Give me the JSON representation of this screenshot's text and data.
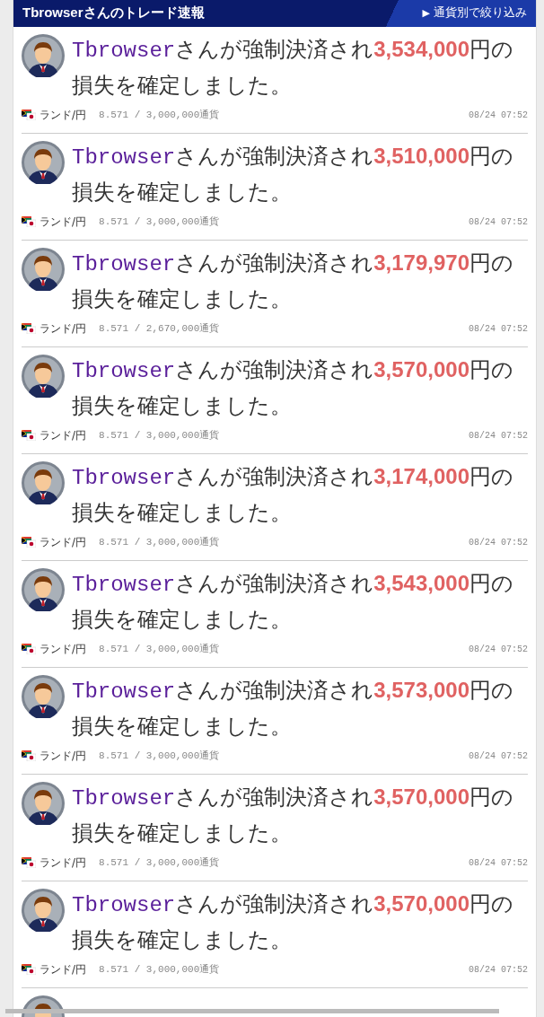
{
  "header": {
    "title": "Tbrowserさんのトレード速報",
    "filter_icon": "▶",
    "filter_label": "通貨別で絞り込み"
  },
  "items": [
    {
      "user": "Tbrowser",
      "text_before": "さんが強制決済され",
      "amount": "3,534,000",
      "text_after": "円の損失を確定しました。",
      "pair": "ランド/円",
      "detail": "8.571 / 3,000,000通貨",
      "time": "08/24 07:52"
    },
    {
      "user": "Tbrowser",
      "text_before": "さんが強制決済され",
      "amount": "3,510,000",
      "text_after": "円の損失を確定しました。",
      "pair": "ランド/円",
      "detail": "8.571 / 3,000,000通貨",
      "time": "08/24 07:52"
    },
    {
      "user": "Tbrowser",
      "text_before": "さんが強制決済され",
      "amount": "3,179,970",
      "text_after": "円の損失を確定しました。",
      "pair": "ランド/円",
      "detail": "8.571 / 2,670,000通貨",
      "time": "08/24 07:52"
    },
    {
      "user": "Tbrowser",
      "text_before": "さんが強制決済され",
      "amount": "3,570,000",
      "text_after": "円の損失を確定しました。",
      "pair": "ランド/円",
      "detail": "8.571 / 3,000,000通貨",
      "time": "08/24 07:52"
    },
    {
      "user": "Tbrowser",
      "text_before": "さんが強制決済され",
      "amount": "3,174,000",
      "text_after": "円の損失を確定しました。",
      "pair": "ランド/円",
      "detail": "8.571 / 3,000,000通貨",
      "time": "08/24 07:52"
    },
    {
      "user": "Tbrowser",
      "text_before": "さんが強制決済され",
      "amount": "3,543,000",
      "text_after": "円の損失を確定しました。",
      "pair": "ランド/円",
      "detail": "8.571 / 3,000,000通貨",
      "time": "08/24 07:52"
    },
    {
      "user": "Tbrowser",
      "text_before": "さんが強制決済され",
      "amount": "3,573,000",
      "text_after": "円の損失を確定しました。",
      "pair": "ランド/円",
      "detail": "8.571 / 3,000,000通貨",
      "time": "08/24 07:52"
    },
    {
      "user": "Tbrowser",
      "text_before": "さんが強制決済され",
      "amount": "3,570,000",
      "text_after": "円の損失を確定しました。",
      "pair": "ランド/円",
      "detail": "8.571 / 3,000,000通貨",
      "time": "08/24 07:52"
    },
    {
      "user": "Tbrowser",
      "text_before": "さんが強制決済され",
      "amount": "3,570,000",
      "text_after": "円の損失を確定しました。",
      "pair": "ランド/円",
      "detail": "8.571 / 3,000,000通貨",
      "time": "08/24 07:52"
    }
  ]
}
